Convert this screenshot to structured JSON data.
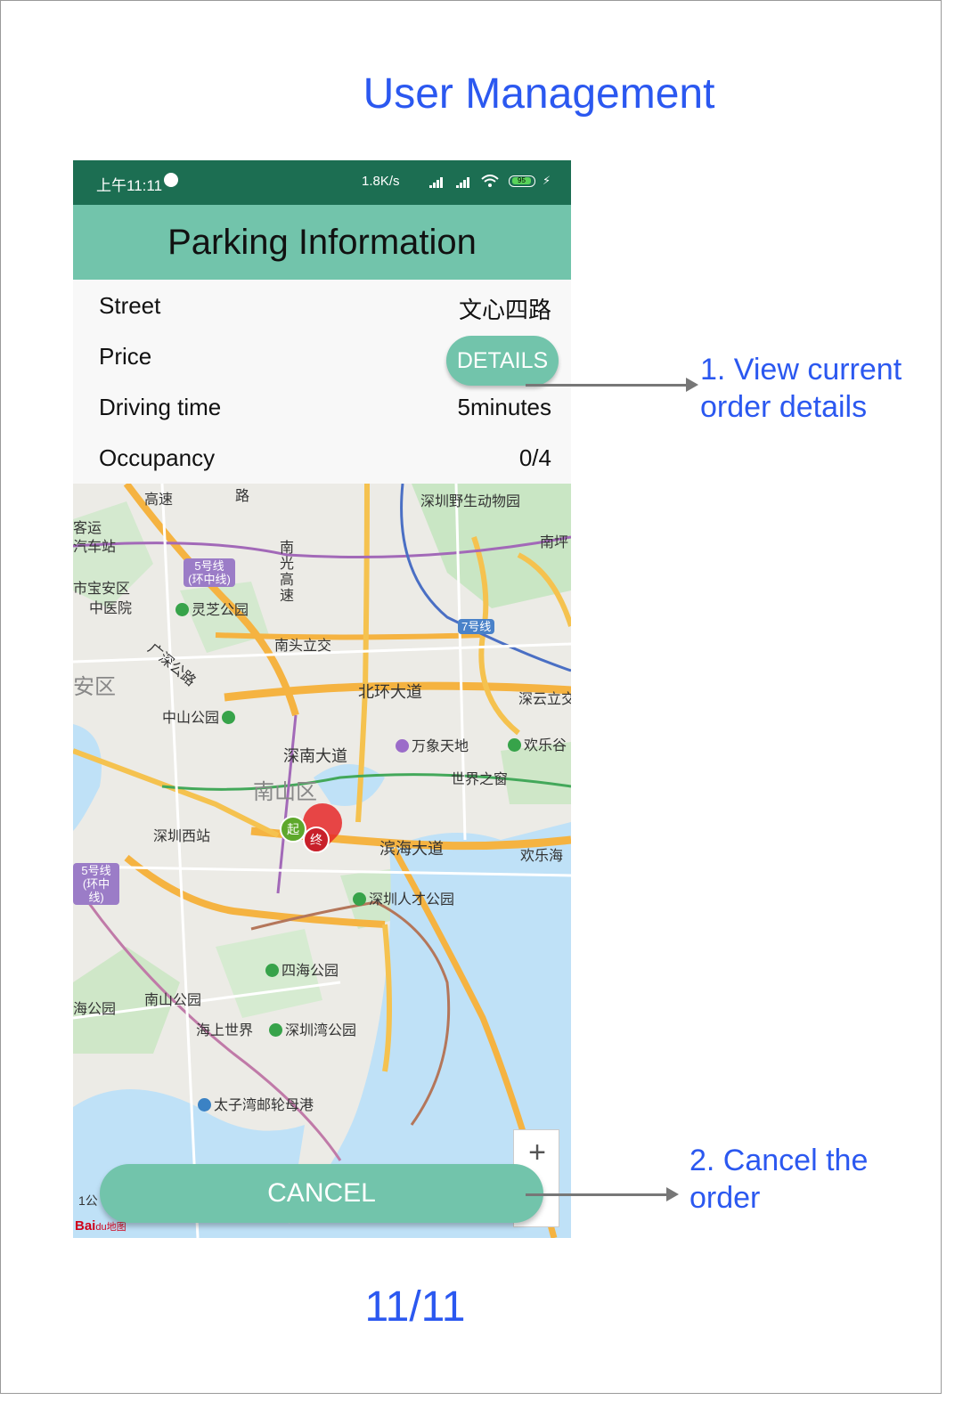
{
  "slide": {
    "title": "User Management",
    "page": "11/11"
  },
  "status_bar": {
    "time": "上午11:11",
    "network_speed": "1.8K/s",
    "battery": "95"
  },
  "app": {
    "title": "Parking Information"
  },
  "rows": [
    {
      "label": "Street",
      "value": "文心四路"
    },
    {
      "label": "Price",
      "button": "DETAILS"
    },
    {
      "label": "Driving time",
      "value": "5minutes"
    },
    {
      "label": "Occupancy",
      "value": "0/4"
    }
  ],
  "map": {
    "labels": {
      "zoo": "深圳野生动物园",
      "nanping": "南坪",
      "bus_station_1": "客运",
      "bus_station_2": "汽车站",
      "line5": "5号线(环中线)",
      "baoan_hospital_1": "市宝安区",
      "baoan_hospital_2": "中医院",
      "lingzhi_park": "灵芝公园",
      "nanguang": "南光高速",
      "line7": "7号线",
      "nantou": "南头立交",
      "guangshen": "广深公路",
      "district": "安区",
      "beihuan": "北环大道",
      "shenyun": "深云立交",
      "zhongshan_park": "中山公园",
      "shennan": "深南大道",
      "mixc": "万象天地",
      "happy_valley": "欢乐谷",
      "window_world": "世界之窗",
      "nanshan": "南山区",
      "shenzhen_west": "深圳西站",
      "binhai": "滨海大道",
      "happy_coast": "欢乐海",
      "line5b": "5号线(环中线)",
      "talent_park": "深圳人才公园",
      "sihai_park": "四海公园",
      "haigong": "海公园",
      "nanshan_park": "南山公园",
      "sea_world": "海上世界",
      "bay_park": "深圳湾公园",
      "cruise_port": "太子湾邮轮母港",
      "road_top": "路",
      "highway_top": "高速",
      "start": "起",
      "end": "终"
    },
    "zoom_plus": "+",
    "scale": "1公",
    "logo": "Bai",
    "logo_du": "du",
    "logo_map": "地图"
  },
  "cancel_button": "CANCEL",
  "annotations": {
    "first": [
      "1. View current",
      "order details"
    ],
    "second": [
      "2. Cancel the",
      "order"
    ]
  },
  "colors": {
    "accent": "#72c4ab",
    "status_bar": "#1c6e52",
    "annotation": "#2b58f0"
  }
}
